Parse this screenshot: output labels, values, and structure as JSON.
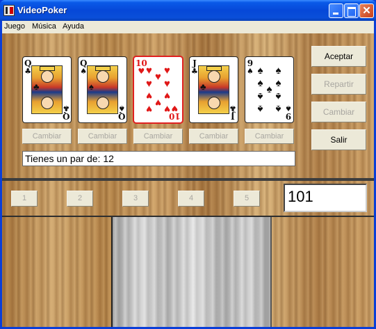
{
  "window": {
    "title": "VideoPoker"
  },
  "menu": [
    {
      "label": "Juego"
    },
    {
      "label": "Música"
    },
    {
      "label": "Ayuda"
    }
  ],
  "cards": [
    {
      "rank": "Q",
      "suit": "♣",
      "color": "black",
      "selected": false
    },
    {
      "rank": "Q",
      "suit": "♠",
      "color": "black",
      "selected": false
    },
    {
      "rank": "10",
      "suit": "♥",
      "color": "red",
      "selected": true
    },
    {
      "rank": "J",
      "suit": "♣",
      "color": "black",
      "selected": false
    },
    {
      "rank": "9",
      "suit": "♠",
      "color": "black",
      "selected": false
    }
  ],
  "change_buttons": [
    {
      "label": "Cambiar",
      "enabled": false
    },
    {
      "label": "Cambiar",
      "enabled": false
    },
    {
      "label": "Cambiar",
      "enabled": false
    },
    {
      "label": "Cambiar",
      "enabled": false
    },
    {
      "label": "Cambiar",
      "enabled": false
    }
  ],
  "side_buttons": {
    "accept": {
      "label": "Aceptar",
      "enabled": true
    },
    "deal": {
      "label": "Repartir",
      "enabled": false
    },
    "change": {
      "label": "Cambiar",
      "enabled": false
    },
    "exit": {
      "label": "Salir",
      "enabled": true
    }
  },
  "message": "Tienes un par de:  12",
  "number_buttons": [
    {
      "label": "1"
    },
    {
      "label": "2"
    },
    {
      "label": "3"
    },
    {
      "label": "4"
    },
    {
      "label": "5"
    }
  ],
  "credits": "101",
  "colors": {
    "title_bar": "#0648d8",
    "wood": "#b88a52",
    "selected_border": "#e02020",
    "button_face": "#ece9d8"
  }
}
